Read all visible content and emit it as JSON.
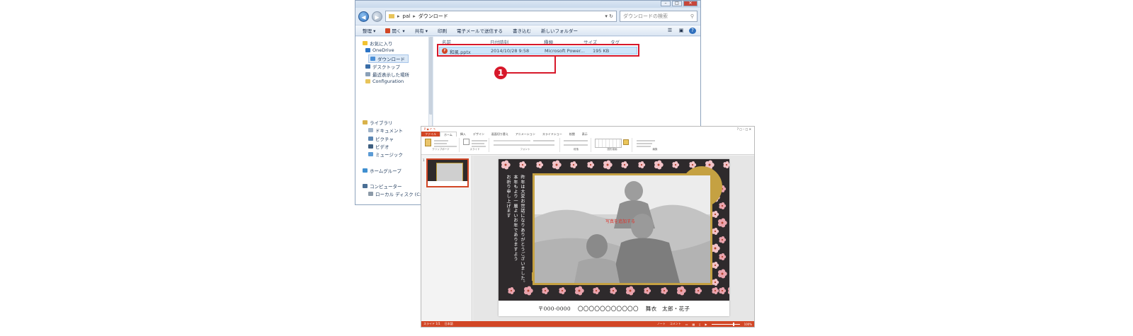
{
  "explorer": {
    "breadcrumb": [
      "pal",
      "ダウンロード"
    ],
    "search_placeholder": "ダウンロードの検索",
    "toolbar": [
      "整理 ▾",
      "開く ▾",
      "共有 ▾",
      "印刷",
      "電子メールで送信する",
      "書き込む",
      "新しいフォルダー"
    ],
    "nav": {
      "favorites": "お気に入り",
      "onedrive": "OneDrive",
      "downloads": "ダウンロード",
      "desktop": "デスクトップ",
      "recent": "最近表示した場所",
      "configuration": "Configuration",
      "libraries": "ライブラリ",
      "documents": "ドキュメント",
      "pictures": "ピクチャ",
      "videos": "ビデオ",
      "music": "ミュージック",
      "homegroup": "ホームグループ",
      "computer": "コンピューター",
      "local_disk": "ローカル ディスク (C:)"
    },
    "columns": {
      "name": "名前",
      "date": "日付時刻",
      "type": "種類",
      "size": "サイズ",
      "tag": "タグ"
    },
    "file": {
      "name": "和風.pptx",
      "date": "2014/10/28 9:58",
      "type": "Microsoft Power...",
      "size": "195 KB"
    }
  },
  "callout": {
    "number": "1",
    "color": "#d7182a"
  },
  "powerpoint": {
    "tabs": [
      "ファイル",
      "ホーム",
      "挿入",
      "デザイン",
      "画面切り替え",
      "アニメーション",
      "スライドショー",
      "校閲",
      "表示"
    ],
    "ribbon_groups": [
      "クリップボード",
      "スライド",
      "フォント",
      "段落",
      "図形描画",
      "編集"
    ],
    "thumb_number": "1",
    "slide": {
      "message_col1": "お祈り申し上げます",
      "message_col2": "本年もより一層よいお年でありますよう",
      "message_col3": "昨年は大変お世話になりありがとうございました。",
      "photo_placeholder": "写真を追加する",
      "postal": "〒000-0000",
      "address": "〇〇〇〇〇〇〇〇〇〇〇",
      "names": "舞衣　太郎・花子"
    },
    "status": {
      "left": "スライド 1/1",
      "lang": "日本語",
      "notes": "ノート",
      "comments": "コメント",
      "zoom": "100%"
    },
    "accent_color": "#d24625",
    "slide_bg": "#2e2a2c",
    "gold": "#c5a142"
  }
}
